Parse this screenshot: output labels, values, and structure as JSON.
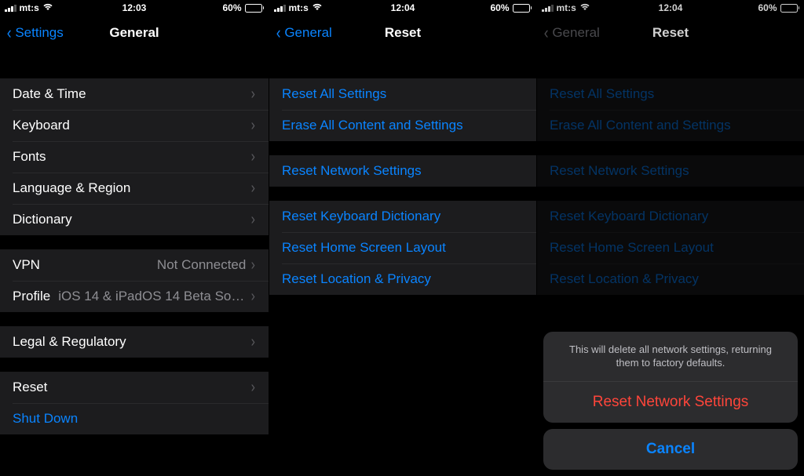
{
  "status": {
    "carrier": "mt:s",
    "battery_text": "60%",
    "battery_level": 60
  },
  "screens": [
    {
      "clock": "12:03",
      "nav": {
        "back": "Settings",
        "title": "General"
      },
      "groups": [
        {
          "type": "gap",
          "h": "big"
        },
        {
          "type": "rows",
          "rows": [
            {
              "label": "Date & Time"
            },
            {
              "label": "Keyboard"
            },
            {
              "label": "Fonts"
            },
            {
              "label": "Language & Region"
            },
            {
              "label": "Dictionary"
            }
          ]
        },
        {
          "type": "gap"
        },
        {
          "type": "rows",
          "rows": [
            {
              "label": "VPN",
              "value": "Not Connected"
            },
            {
              "label": "Profile",
              "value": "iOS 14 & iPadOS 14 Beta Softwar..."
            }
          ]
        },
        {
          "type": "gap"
        },
        {
          "type": "rows",
          "rows": [
            {
              "label": "Legal & Regulatory"
            }
          ]
        },
        {
          "type": "gap"
        },
        {
          "type": "rows",
          "rows": [
            {
              "label": "Reset"
            },
            {
              "label": "Shut Down",
              "blue": true,
              "noarrow": true
            }
          ]
        }
      ]
    },
    {
      "clock": "12:04",
      "nav": {
        "back": "General",
        "title": "Reset"
      },
      "groups": [
        {
          "type": "gap",
          "h": "big"
        },
        {
          "type": "rows",
          "rows": [
            {
              "label": "Reset All Settings",
              "blue": true,
              "noarrow": true
            },
            {
              "label": "Erase All Content and Settings",
              "blue": true,
              "noarrow": true
            }
          ]
        },
        {
          "type": "gap"
        },
        {
          "type": "rows",
          "rows": [
            {
              "label": "Reset Network Settings",
              "blue": true,
              "noarrow": true
            }
          ]
        },
        {
          "type": "gap"
        },
        {
          "type": "rows",
          "rows": [
            {
              "label": "Reset Keyboard Dictionary",
              "blue": true,
              "noarrow": true
            },
            {
              "label": "Reset Home Screen Layout",
              "blue": true,
              "noarrow": true
            },
            {
              "label": "Reset Location & Privacy",
              "blue": true,
              "noarrow": true
            }
          ]
        }
      ]
    },
    {
      "clock": "12:04",
      "nav": {
        "back": "General",
        "title": "Reset",
        "dimmed": true
      },
      "groups": [
        {
          "type": "gap",
          "h": "big"
        },
        {
          "type": "rows",
          "rows": [
            {
              "label": "Reset All Settings",
              "blue": true,
              "noarrow": true
            },
            {
              "label": "Erase All Content and Settings",
              "blue": true,
              "noarrow": true
            }
          ]
        },
        {
          "type": "gap"
        },
        {
          "type": "rows",
          "rows": [
            {
              "label": "Reset Network Settings",
              "blue": true,
              "noarrow": true
            }
          ]
        },
        {
          "type": "gap"
        },
        {
          "type": "rows",
          "rows": [
            {
              "label": "Reset Keyboard Dictionary",
              "blue": true,
              "noarrow": true
            },
            {
              "label": "Reset Home Screen Layout",
              "blue": true,
              "noarrow": true
            },
            {
              "label": "Reset Location & Privacy",
              "blue": true,
              "noarrow": true
            }
          ]
        }
      ],
      "sheet": {
        "message": "This will delete all network settings, returning them to factory defaults.",
        "action": "Reset Network Settings",
        "cancel": "Cancel"
      }
    }
  ]
}
